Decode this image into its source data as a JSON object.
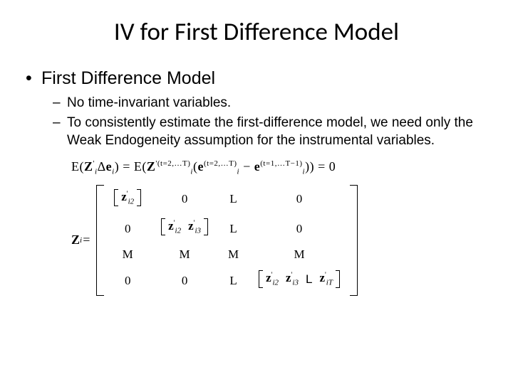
{
  "title": "IV for First Difference Model",
  "l1_bullet": "•",
  "l2_bullet": "–",
  "heading1": "First Difference Model",
  "point1": "No time-invariant variables.",
  "point2": "To consistently estimate the first-difference model, we need only the Weak Endogeneity assumption for the instrumental variables.",
  "eqn": {
    "E1": "E",
    "lp": "(",
    "rp": ")",
    "Z": "Z",
    "prime": "'",
    "sub_i": "i",
    "Delta": "Δ",
    "e": "e",
    "eq": " = ",
    "sup_t2T": "(t=2,…T)",
    "sup_t2Tb": "(t=2,…T)",
    "minus": " − ",
    "sup_t1Tm1": "(t=1,…T−1)",
    "eq0": " = 0"
  },
  "matrix": {
    "lhs_Z": "Z",
    "lhs_sub": "i",
    "lhs_eq": " = ",
    "z": "z",
    "i2": "i2",
    "i3": "i3",
    "iT": "iT",
    "zero": "0",
    "L": "L",
    "M": "M"
  }
}
